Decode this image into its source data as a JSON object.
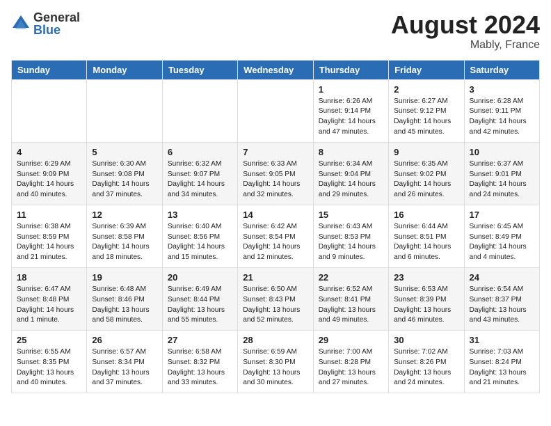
{
  "logo": {
    "general": "General",
    "blue": "Blue"
  },
  "title": {
    "month_year": "August 2024",
    "location": "Mably, France"
  },
  "headers": [
    "Sunday",
    "Monday",
    "Tuesday",
    "Wednesday",
    "Thursday",
    "Friday",
    "Saturday"
  ],
  "weeks": [
    [
      {
        "day": "",
        "info": ""
      },
      {
        "day": "",
        "info": ""
      },
      {
        "day": "",
        "info": ""
      },
      {
        "day": "",
        "info": ""
      },
      {
        "day": "1",
        "info": "Sunrise: 6:26 AM\nSunset: 9:14 PM\nDaylight: 14 hours\nand 47 minutes."
      },
      {
        "day": "2",
        "info": "Sunrise: 6:27 AM\nSunset: 9:12 PM\nDaylight: 14 hours\nand 45 minutes."
      },
      {
        "day": "3",
        "info": "Sunrise: 6:28 AM\nSunset: 9:11 PM\nDaylight: 14 hours\nand 42 minutes."
      }
    ],
    [
      {
        "day": "4",
        "info": "Sunrise: 6:29 AM\nSunset: 9:09 PM\nDaylight: 14 hours\nand 40 minutes."
      },
      {
        "day": "5",
        "info": "Sunrise: 6:30 AM\nSunset: 9:08 PM\nDaylight: 14 hours\nand 37 minutes."
      },
      {
        "day": "6",
        "info": "Sunrise: 6:32 AM\nSunset: 9:07 PM\nDaylight: 14 hours\nand 34 minutes."
      },
      {
        "day": "7",
        "info": "Sunrise: 6:33 AM\nSunset: 9:05 PM\nDaylight: 14 hours\nand 32 minutes."
      },
      {
        "day": "8",
        "info": "Sunrise: 6:34 AM\nSunset: 9:04 PM\nDaylight: 14 hours\nand 29 minutes."
      },
      {
        "day": "9",
        "info": "Sunrise: 6:35 AM\nSunset: 9:02 PM\nDaylight: 14 hours\nand 26 minutes."
      },
      {
        "day": "10",
        "info": "Sunrise: 6:37 AM\nSunset: 9:01 PM\nDaylight: 14 hours\nand 24 minutes."
      }
    ],
    [
      {
        "day": "11",
        "info": "Sunrise: 6:38 AM\nSunset: 8:59 PM\nDaylight: 14 hours\nand 21 minutes."
      },
      {
        "day": "12",
        "info": "Sunrise: 6:39 AM\nSunset: 8:58 PM\nDaylight: 14 hours\nand 18 minutes."
      },
      {
        "day": "13",
        "info": "Sunrise: 6:40 AM\nSunset: 8:56 PM\nDaylight: 14 hours\nand 15 minutes."
      },
      {
        "day": "14",
        "info": "Sunrise: 6:42 AM\nSunset: 8:54 PM\nDaylight: 14 hours\nand 12 minutes."
      },
      {
        "day": "15",
        "info": "Sunrise: 6:43 AM\nSunset: 8:53 PM\nDaylight: 14 hours\nand 9 minutes."
      },
      {
        "day": "16",
        "info": "Sunrise: 6:44 AM\nSunset: 8:51 PM\nDaylight: 14 hours\nand 6 minutes."
      },
      {
        "day": "17",
        "info": "Sunrise: 6:45 AM\nSunset: 8:49 PM\nDaylight: 14 hours\nand 4 minutes."
      }
    ],
    [
      {
        "day": "18",
        "info": "Sunrise: 6:47 AM\nSunset: 8:48 PM\nDaylight: 14 hours\nand 1 minute."
      },
      {
        "day": "19",
        "info": "Sunrise: 6:48 AM\nSunset: 8:46 PM\nDaylight: 13 hours\nand 58 minutes."
      },
      {
        "day": "20",
        "info": "Sunrise: 6:49 AM\nSunset: 8:44 PM\nDaylight: 13 hours\nand 55 minutes."
      },
      {
        "day": "21",
        "info": "Sunrise: 6:50 AM\nSunset: 8:43 PM\nDaylight: 13 hours\nand 52 minutes."
      },
      {
        "day": "22",
        "info": "Sunrise: 6:52 AM\nSunset: 8:41 PM\nDaylight: 13 hours\nand 49 minutes."
      },
      {
        "day": "23",
        "info": "Sunrise: 6:53 AM\nSunset: 8:39 PM\nDaylight: 13 hours\nand 46 minutes."
      },
      {
        "day": "24",
        "info": "Sunrise: 6:54 AM\nSunset: 8:37 PM\nDaylight: 13 hours\nand 43 minutes."
      }
    ],
    [
      {
        "day": "25",
        "info": "Sunrise: 6:55 AM\nSunset: 8:35 PM\nDaylight: 13 hours\nand 40 minutes."
      },
      {
        "day": "26",
        "info": "Sunrise: 6:57 AM\nSunset: 8:34 PM\nDaylight: 13 hours\nand 37 minutes."
      },
      {
        "day": "27",
        "info": "Sunrise: 6:58 AM\nSunset: 8:32 PM\nDaylight: 13 hours\nand 33 minutes."
      },
      {
        "day": "28",
        "info": "Sunrise: 6:59 AM\nSunset: 8:30 PM\nDaylight: 13 hours\nand 30 minutes."
      },
      {
        "day": "29",
        "info": "Sunrise: 7:00 AM\nSunset: 8:28 PM\nDaylight: 13 hours\nand 27 minutes."
      },
      {
        "day": "30",
        "info": "Sunrise: 7:02 AM\nSunset: 8:26 PM\nDaylight: 13 hours\nand 24 minutes."
      },
      {
        "day": "31",
        "info": "Sunrise: 7:03 AM\nSunset: 8:24 PM\nDaylight: 13 hours\nand 21 minutes."
      }
    ]
  ]
}
